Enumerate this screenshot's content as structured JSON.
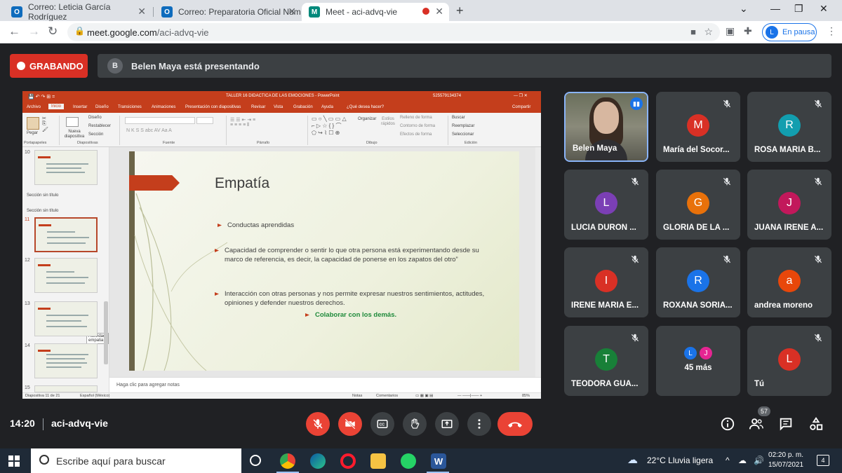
{
  "browser": {
    "tabs": [
      {
        "title": "Correo: Leticia García Rodríguez",
        "favicon": "O"
      },
      {
        "title": "Correo: Preparatoria Oficial Num",
        "favicon": "O"
      },
      {
        "title": "Meet - aci-advq-vie",
        "favicon": "M"
      }
    ],
    "url_host": "meet.google.com",
    "url_path": "/aci-advq-vie",
    "profile_initial": "L",
    "pause_label": "En pausa"
  },
  "meet": {
    "recording_label": "GRABANDO",
    "presenter_initial": "B",
    "presenting_text": "Belen Maya está presentando",
    "time": "14:20",
    "meeting_code": "aci-advq-vie",
    "people_count": "57",
    "participants": [
      {
        "name": "Belen Maya",
        "initial": "",
        "color": "",
        "speaking": true
      },
      {
        "name": "María del Socor...",
        "initial": "M",
        "color": "#d93025"
      },
      {
        "name": "ROSA MARIA B...",
        "initial": "R",
        "color": "#129eaf"
      },
      {
        "name": "LUCIA DURON ...",
        "initial": "L",
        "color": "#7b3fb5"
      },
      {
        "name": "GLORIA DE LA ...",
        "initial": "G",
        "color": "#e8710a"
      },
      {
        "name": "JUANA IRENE A...",
        "initial": "J",
        "color": "#c2185b"
      },
      {
        "name": "IRENE MARIA E...",
        "initial": "I",
        "color": "#d93025"
      },
      {
        "name": "ROXANA SORIA...",
        "initial": "R",
        "color": "#1a73e8"
      },
      {
        "name": "andrea moreno",
        "initial": "a",
        "color": "#e8470a"
      },
      {
        "name": "TEODORA GUA...",
        "initial": "T",
        "color": "#188038"
      },
      {
        "name": "45 más",
        "initial": "L",
        "initial2": "J"
      },
      {
        "name": "Tú",
        "initial": "L",
        "color": "#d93025"
      }
    ]
  },
  "ppt": {
    "window_title": "TALLER 16 DIDACTICA DE LAS EMOCIONES - PowerPoint",
    "user_id": "525579134374",
    "tabs": [
      "Archivo",
      "Inicio",
      "Insertar",
      "Diseño",
      "Transiciones",
      "Animaciones",
      "Presentación con diapositivas",
      "Revisar",
      "Vista",
      "Grabación",
      "Ayuda",
      "¿Qué desea hacer?",
      "Compartir"
    ],
    "ribbon": {
      "pegar": "Pegar",
      "nueva": "Nueva diapositiva",
      "diseno": "Diseño",
      "restablecer": "Restablecer",
      "seccion": "Sección",
      "organizar": "Organizar",
      "estilos": "Estilos rápidos",
      "relleno": "Relleno de forma",
      "contorno": "Contorno de forma",
      "efectos": "Efectos de forma",
      "buscar": "Buscar",
      "reemplazar": "Reemplazar",
      "seleccionar": "Seleccionar",
      "groups": [
        "Portapapeles",
        "Diapositivas",
        "Fuente",
        "Párrafo",
        "Dibujo",
        "Edición"
      ]
    },
    "thumbs": {
      "nums": [
        "10",
        "11",
        "12",
        "13",
        "14",
        "15"
      ],
      "section1": "Sección sin título",
      "section2": "Sección sin título",
      "tooltip": "Actividad empatia"
    },
    "slide": {
      "title": "Empatía",
      "b1": "Conductas aprendidas",
      "b2": "Capacidad de comprender o sentir lo que otra persona está experimentando desde su marco de referencia, es decir, la capacidad de ponerse en los zapatos del otro”",
      "b3": "Interacción  con otras personas y nos permite expresar nuestros sentimientos, actitudes, opiniones y defender nuestros derechos.",
      "b4": "Colaborar con los demás."
    },
    "notes_placeholder": "Haga clic para agregar notas",
    "status": {
      "slide_count": "Diapositiva 11 de 21",
      "language": "Español (México)",
      "notas": "Notas",
      "comentarios": "Comentarios",
      "zoom": "85%"
    }
  },
  "taskbar": {
    "search_placeholder": "Escribe aquí para buscar",
    "weather": "22°C  Lluvia ligera",
    "clock_time": "02:20 p. m.",
    "clock_date": "15/07/2021",
    "notif_count": "4"
  }
}
